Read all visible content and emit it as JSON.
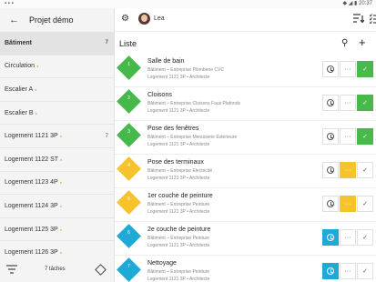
{
  "statusbar": {
    "left": "▪ ▪ ▪",
    "right": "◆ ◢ ▮ 20:37"
  },
  "sidebar": {
    "title": "Projet démo",
    "items": [
      {
        "label": "Bâtiment",
        "count": "7",
        "active": true
      },
      {
        "label": "Circulation",
        "dot": "●",
        "count": ""
      },
      {
        "label": "Escalier A",
        "dot": "●",
        "count": ""
      },
      {
        "label": "Escalier B",
        "dot": "●",
        "count": ""
      },
      {
        "label": "Logement 1121 3P",
        "dot": "●",
        "count": "7"
      },
      {
        "label": "Logement 1122 ST",
        "dot": "●",
        "count": ""
      },
      {
        "label": "Logement 1123 4P",
        "dot": "●",
        "count": ""
      },
      {
        "label": "Logement 1124 3P",
        "dot": "●",
        "count": ""
      },
      {
        "label": "Logement 1125 3P",
        "dot": "●",
        "count": ""
      },
      {
        "label": "Logement 1126 3P",
        "dot": "●",
        "count": ""
      }
    ],
    "footer_tasks": "7 tâches"
  },
  "topbar": {
    "user": "Lea"
  },
  "main": {
    "title": "Liste",
    "tasks": [
      {
        "num": "1",
        "name": "Salle de bain",
        "sub": "Bâtiment – Entreprise Plomberie CVC",
        "sub2": "Logement 1121 3P • Architecte",
        "color": "#47b84a"
      },
      {
        "num": "2",
        "name": "Cloisons",
        "sub": "Bâtiment – Entreprise Cloisons Faux Plafonds",
        "sub2": "Logement 1121 3P • Architecte",
        "color": "#47b84a"
      },
      {
        "num": "3",
        "name": "Pose des fenêtres",
        "sub": "Bâtiment – Entreprise Menuiserie Extérieure",
        "sub2": "Logement 1121 3P • Architecte",
        "color": "#47b84a"
      },
      {
        "num": "4",
        "name": "Pose des terminaux",
        "sub": "Bâtiment – Entreprise Electricité",
        "sub2": "Logement 1121 3P • Architecte",
        "color": "#f7c32c"
      },
      {
        "num": "5",
        "name": "1er couche de peinture",
        "sub": "Bâtiment – Entreprise Peinture",
        "sub2": "Logement 1121 3P • Architecte",
        "color": "#f7c32c"
      },
      {
        "num": "6",
        "name": "2e couche de peinture",
        "sub": "Bâtiment – Entreprise Peinture",
        "sub2": "Logement 1121 3P • Architecte",
        "color": "#1fa9d6"
      },
      {
        "num": "7",
        "name": "Nettoyage",
        "sub": "Bâtiment – Entreprise Peinture",
        "sub2": "Logement 1121 3P • Architecte",
        "color": "#1fa9d6"
      }
    ]
  },
  "icons": {
    "back": "←",
    "gear": "⚙",
    "search": "⚲",
    "plus": "+",
    "check": "✓",
    "more": "···"
  }
}
